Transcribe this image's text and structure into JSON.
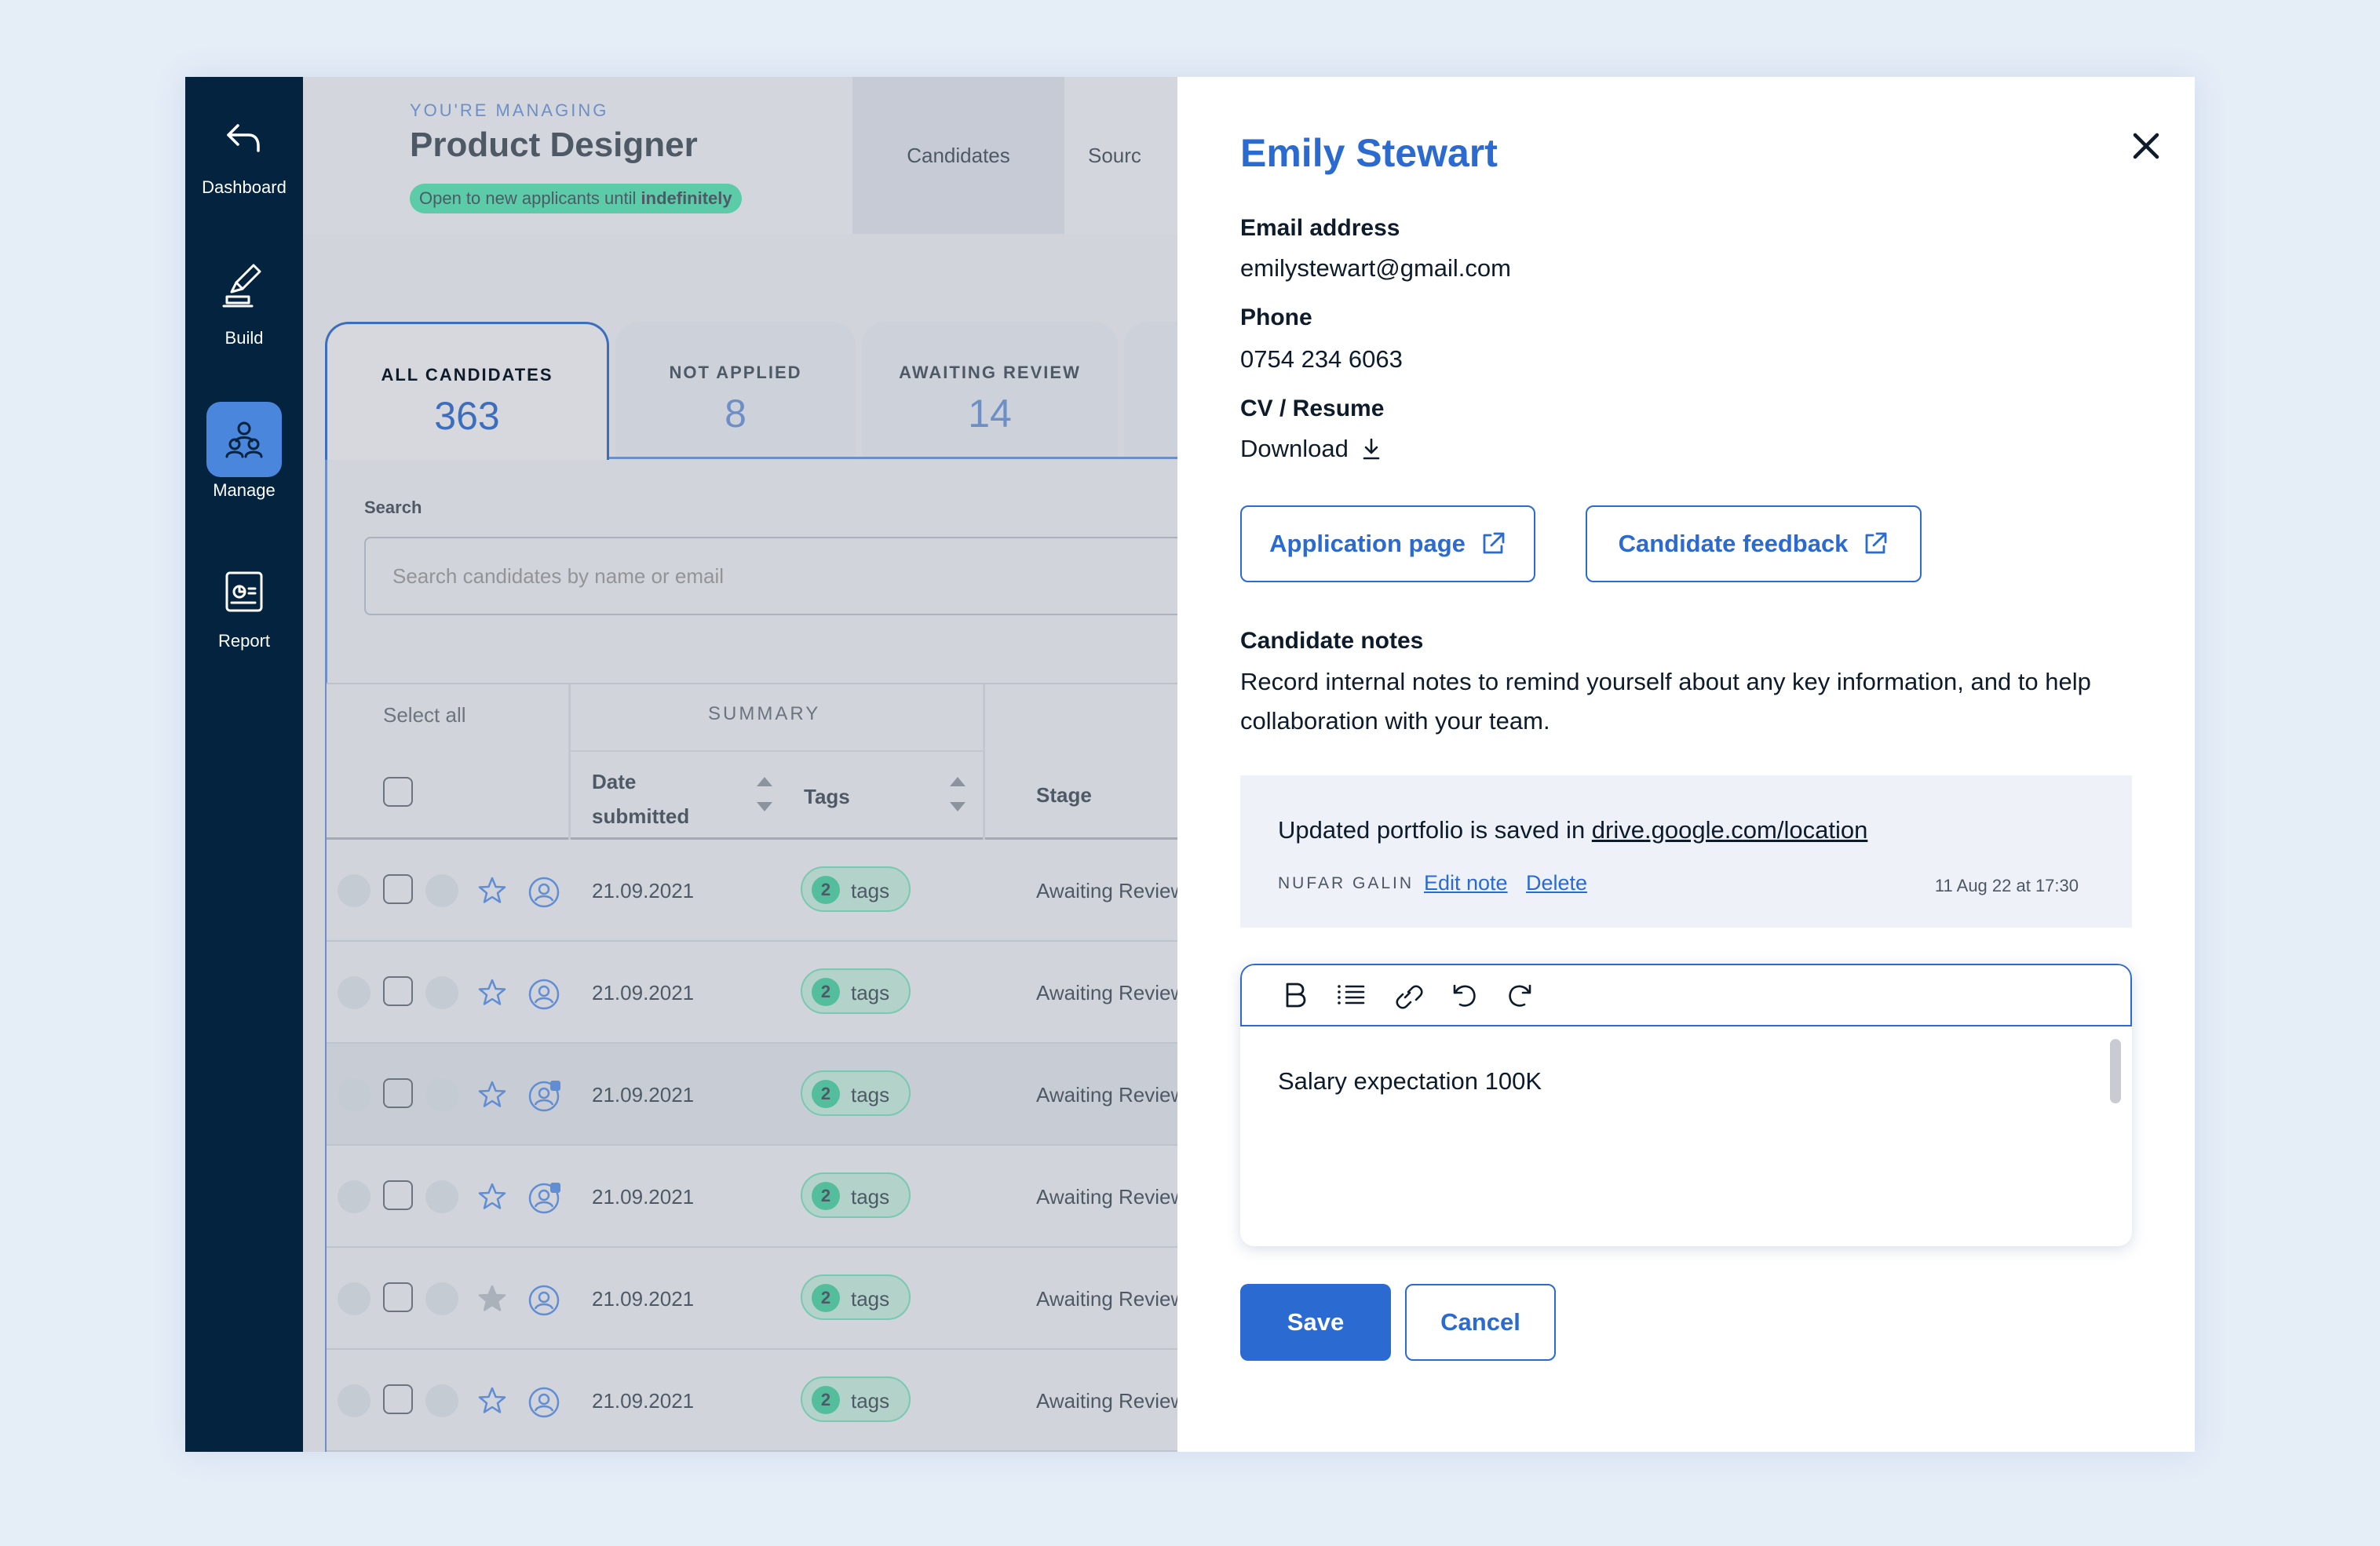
{
  "sidebar": {
    "items": [
      {
        "label": "Dashboard",
        "icon": "back-arrow-icon"
      },
      {
        "label": "Build",
        "icon": "pen-icon"
      },
      {
        "label": "Manage",
        "icon": "people-icon"
      },
      {
        "label": "Report",
        "icon": "report-icon"
      }
    ],
    "active": "Manage"
  },
  "job": {
    "eyebrow": "YOU'RE MANAGING",
    "title": "Product Designer",
    "status_prefix": "Open to new applicants until ",
    "status_bold": "indefinitely"
  },
  "header_tabs": [
    "Candidates",
    "Sourc"
  ],
  "count_tabs": [
    {
      "label": "ALL CANDIDATES",
      "count": "363"
    },
    {
      "label": "NOT APPLIED",
      "count": "8"
    },
    {
      "label": "AWAITING REVIEW",
      "count": "14"
    }
  ],
  "search": {
    "label": "Search",
    "placeholder": "Search candidates by name or email"
  },
  "table": {
    "select_all": "Select all",
    "summary": "SUMMARY",
    "col_date_1": "Date",
    "col_date_2": "submitted",
    "col_tags": "Tags",
    "col_stage": "Stage",
    "rows": [
      {
        "date": "21.09.2021",
        "tag_count": "2",
        "tag_label": "tags",
        "stage": "Awaiting Review"
      },
      {
        "date": "21.09.2021",
        "tag_count": "2",
        "tag_label": "tags",
        "stage": "Awaiting Review"
      },
      {
        "date": "21.09.2021",
        "tag_count": "2",
        "tag_label": "tags",
        "stage": "Awaiting Review"
      },
      {
        "date": "21.09.2021",
        "tag_count": "2",
        "tag_label": "tags",
        "stage": "Awaiting Review"
      },
      {
        "date": "21.09.2021",
        "tag_count": "2",
        "tag_label": "tags",
        "stage": "Awaiting Review"
      },
      {
        "date": "21.09.2021",
        "tag_count": "2",
        "tag_label": "tags",
        "stage": "Awaiting Review"
      }
    ]
  },
  "drawer": {
    "name": "Emily Stewart",
    "email_label": "Email address",
    "email": "emilystewart@gmail.com",
    "phone_label": "Phone",
    "phone": "0754 234 6063",
    "cv_label": "CV / Resume",
    "download": "Download",
    "application_page": "Application page",
    "candidate_feedback": "Candidate feedback",
    "notes_title": "Candidate notes",
    "notes_desc": "Record internal notes to remind yourself about any key information, and to help collaboration with your team.",
    "note": {
      "text_prefix": "Updated portfolio is saved in ",
      "link": "drive.google.com/location",
      "author": "NUFAR GALIN",
      "edit": "Edit note",
      "delete": "Delete",
      "time": "11 Aug 22 at 17:30"
    },
    "editor_text": "Salary expectation 100K",
    "save": "Save",
    "cancel": "Cancel"
  },
  "colors": {
    "sidebar": "#03233f",
    "accent": "#2a6ad1",
    "badge_green": "#21c98f",
    "background": "#e5edf7"
  }
}
